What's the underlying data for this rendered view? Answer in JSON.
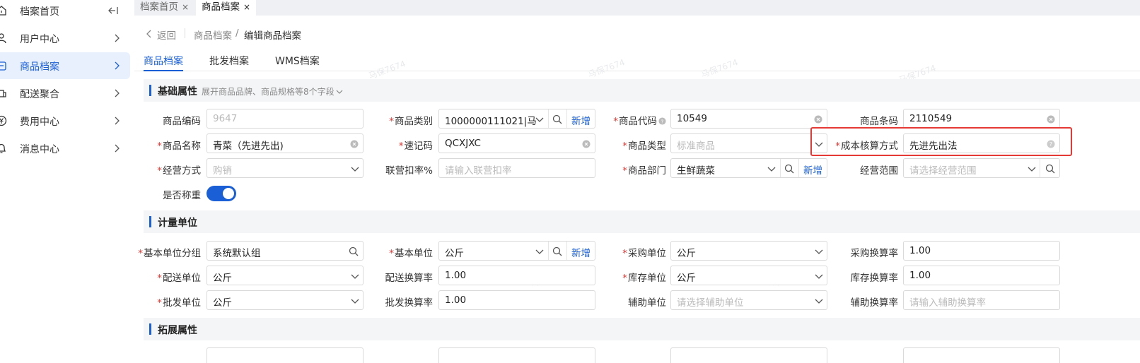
{
  "sidebar": {
    "items": [
      {
        "label": "档案首页",
        "icon": "home-icon"
      },
      {
        "label": "用户中心",
        "icon": "user-icon"
      },
      {
        "label": "商品档案",
        "icon": "goods-icon"
      },
      {
        "label": "配送聚合",
        "icon": "delivery-icon"
      },
      {
        "label": "费用中心",
        "icon": "yen-icon"
      },
      {
        "label": "消息中心",
        "icon": "bell-icon"
      }
    ]
  },
  "tabs": [
    {
      "label": "档案首页",
      "close": "×"
    },
    {
      "label": "商品档案",
      "close": "×"
    }
  ],
  "breadcrumb": {
    "back": "返回",
    "parent": "商品档案",
    "sep": "/",
    "current": "编辑商品档案"
  },
  "subtabs": [
    "商品档案",
    "批发档案",
    "WMS档案"
  ],
  "watermark": "马保7674",
  "sections": {
    "basic": {
      "title": "基础属性",
      "hint": "展开商品品牌、商品规格等8个字段"
    },
    "unit": {
      "title": "计量单位"
    },
    "ext": {
      "title": "拓展属性"
    }
  },
  "add_label": "新增",
  "fields": {
    "goods_code": {
      "label": "商品编码",
      "placeholder": "9647"
    },
    "goods_category": {
      "label": "商品类别",
      "value": "1000000111021|马"
    },
    "goods_daicode": {
      "label": "商品代码",
      "value": "10549"
    },
    "goods_barcode": {
      "label": "商品条码",
      "value": "2110549"
    },
    "goods_name": {
      "label": "商品名称",
      "value": "青菜（先进先出)"
    },
    "quick_code": {
      "label": "速记码",
      "value": "QCXJXC"
    },
    "goods_type": {
      "label": "商品类型",
      "placeholder": "标准商品"
    },
    "cost_method": {
      "label": "成本核算方式",
      "value": "先进先出法"
    },
    "business_mode": {
      "label": "经营方式",
      "placeholder": "购销"
    },
    "joint_rate": {
      "label": "联营扣率%",
      "placeholder": "请输入联营扣率"
    },
    "goods_dept": {
      "label": "商品部门",
      "value": "生鲜蔬菜"
    },
    "business_scope": {
      "label": "经营范围",
      "placeholder": "请选择经营范围"
    },
    "is_weighing": {
      "label": "是否称重",
      "on": true
    },
    "base_unit_group": {
      "label": "基本单位分组",
      "value": "系统默认组"
    },
    "base_unit": {
      "label": "基本单位",
      "value": "公斤"
    },
    "purchase_unit": {
      "label": "采购单位",
      "value": "公斤"
    },
    "purchase_rate": {
      "label": "采购换算率",
      "value": "1.00"
    },
    "delivery_unit": {
      "label": "配送单位",
      "value": "公斤"
    },
    "delivery_rate": {
      "label": "配送换算率",
      "value": "1.00"
    },
    "stock_unit": {
      "label": "库存单位",
      "value": "公斤"
    },
    "stock_rate": {
      "label": "库存换算率",
      "value": "1.00"
    },
    "wholesale_unit": {
      "label": "批发单位",
      "value": "公斤"
    },
    "wholesale_rate": {
      "label": "批发换算率",
      "value": "1.00"
    },
    "aux_unit": {
      "label": "辅助单位",
      "placeholder": "请选择辅助单位"
    },
    "aux_rate": {
      "label": "辅助换算率",
      "placeholder": "请输入辅助换算率"
    }
  },
  "colors": {
    "accent": "#1a5fd6",
    "required": "#e53935",
    "highlight": "#e53935"
  }
}
